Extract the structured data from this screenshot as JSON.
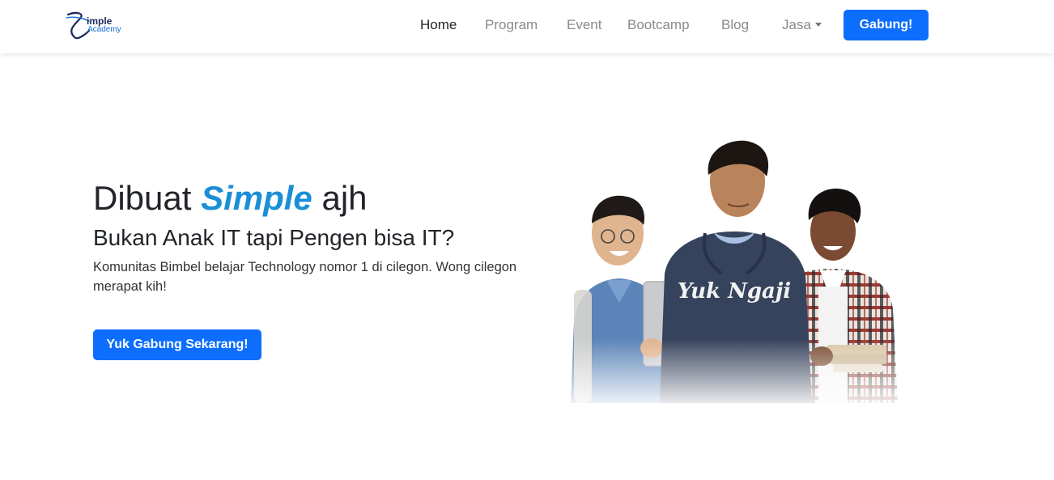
{
  "brand": {
    "line1": "imple",
    "line2": "Academy"
  },
  "nav": {
    "items": [
      {
        "label": "Home",
        "active": true
      },
      {
        "label": "Program",
        "active": false
      },
      {
        "label": "Event",
        "active": false
      },
      {
        "label": "Bootcamp",
        "active": false
      },
      {
        "label": "Blog",
        "active": false
      },
      {
        "label": "Jasa",
        "active": false,
        "dropdown": true
      }
    ],
    "cta_label": "Gabung!"
  },
  "hero": {
    "title_pre": "Dibuat ",
    "title_accent": "Simple",
    "title_post": " ajh",
    "subtitle": "Bukan Anak IT tapi Pengen bisa IT?",
    "description": "Komunitas Bimbel belajar Technology nomor 1 di cilegon. Wong cilegon merapat kih!",
    "cta_label": "Yuk Gabung Sekarang!",
    "image_hoodie_text": "Yuk Ngaji"
  },
  "colors": {
    "primary": "#0d6efd",
    "accent": "#1a8fd6",
    "text": "#212529",
    "muted": "#8a8a8a"
  }
}
